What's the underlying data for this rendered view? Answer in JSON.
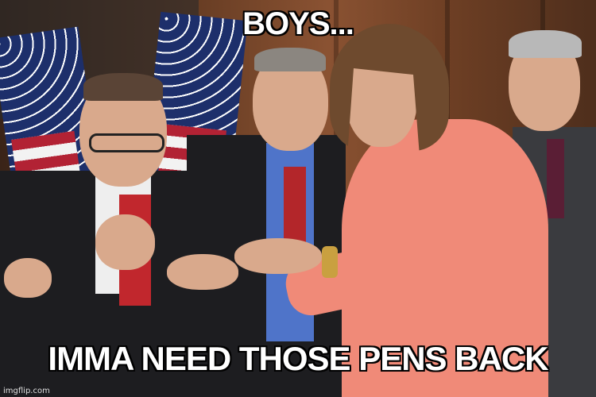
{
  "meme": {
    "top_text": "BOYS...",
    "bottom_text": "IMMA NEED THOSE PENS BACK",
    "watermark": "imgflip.com"
  }
}
